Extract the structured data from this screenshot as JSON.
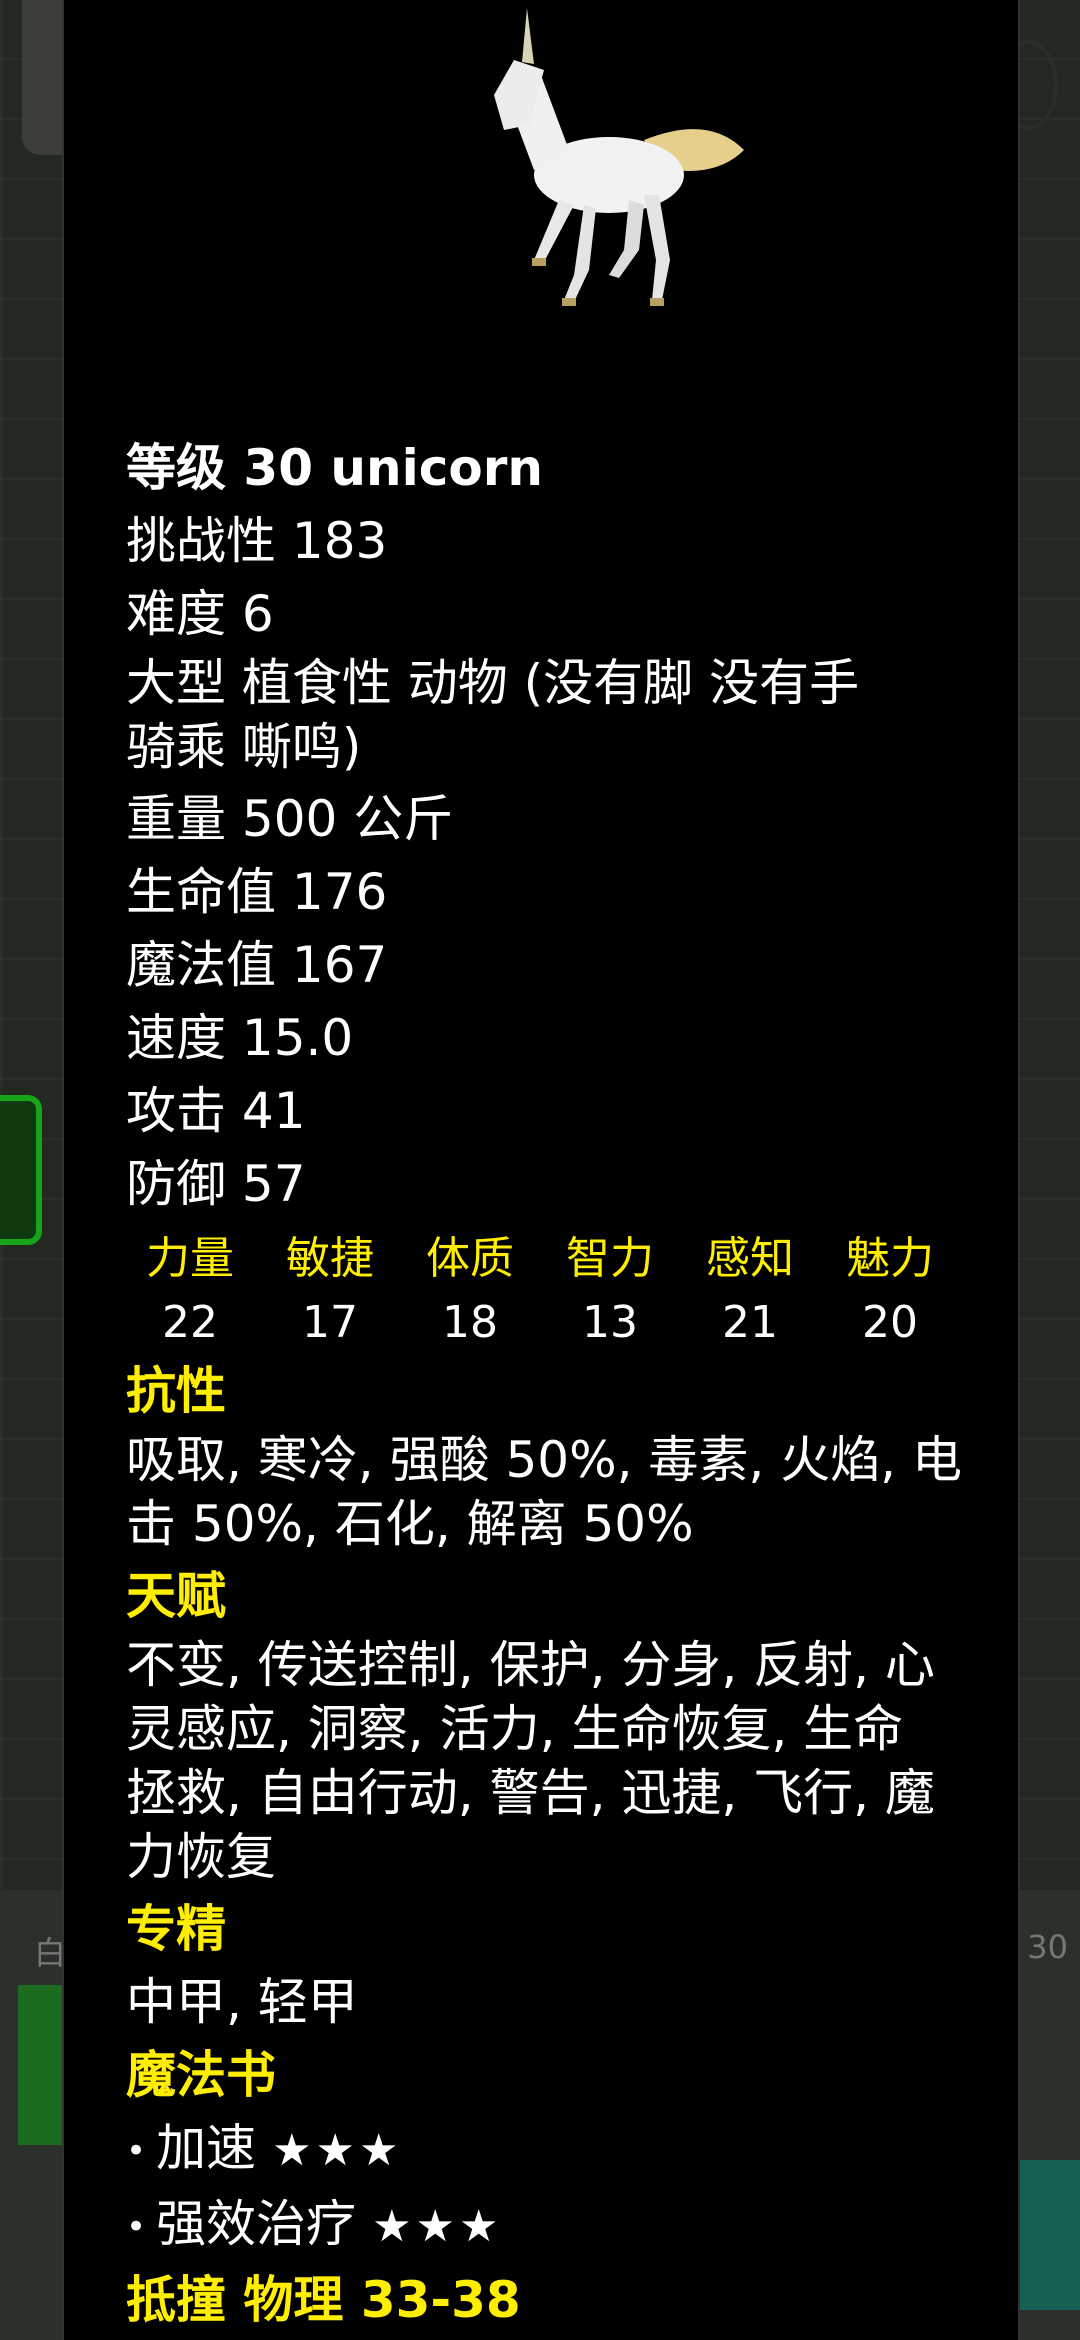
{
  "background": {
    "bottom_left_text": "白",
    "bottom_right_text": "30"
  },
  "monster": {
    "portrait_icon": "unicorn-image",
    "title": "等级 30 unicorn",
    "challenge": "挑战性 183",
    "difficulty": "难度 6",
    "type_line1": "大型 植食性 动物 (没有脚 没有手",
    "type_line2": "骑乘 嘶鸣)",
    "weight": "重量 500 公斤",
    "hp": "生命值 176",
    "mp": "魔法值 167",
    "speed": "速度 15.0",
    "attack": "攻击 41",
    "defense": "防御 57"
  },
  "attributes": [
    {
      "name": "力量",
      "value": "22"
    },
    {
      "name": "敏捷",
      "value": "17"
    },
    {
      "name": "体质",
      "value": "18"
    },
    {
      "name": "智力",
      "value": "13"
    },
    {
      "name": "感知",
      "value": "21"
    },
    {
      "name": "魅力",
      "value": "20"
    }
  ],
  "sections": {
    "resist_title": "抗性",
    "resist_line1": "吸取, 寒冷, 强酸 50%, 毒素, 火焰, 电",
    "resist_line2": "击 50%, 石化, 解离 50%",
    "talent_title": "天赋",
    "talent_line1": "不变, 传送控制, 保护, 分身, 反射, 心",
    "talent_line2": "灵感应, 洞察, 活力, 生命恢复, 生命",
    "talent_line3": "拯救, 自由行动, 警告, 迅捷, 飞行, 魔",
    "talent_line4": "力恢复",
    "mastery_title": "专精",
    "mastery_text": "中甲, 轻甲",
    "spellbook_title": "魔法书",
    "spells": [
      {
        "name": "加速",
        "stars": "★★★"
      },
      {
        "name": "强效治疗",
        "stars": "★★★"
      }
    ],
    "melee": "抵撞 物理 33-38"
  },
  "colors": {
    "accent_yellow": "#ffee00",
    "popup_bg": "#000000"
  }
}
